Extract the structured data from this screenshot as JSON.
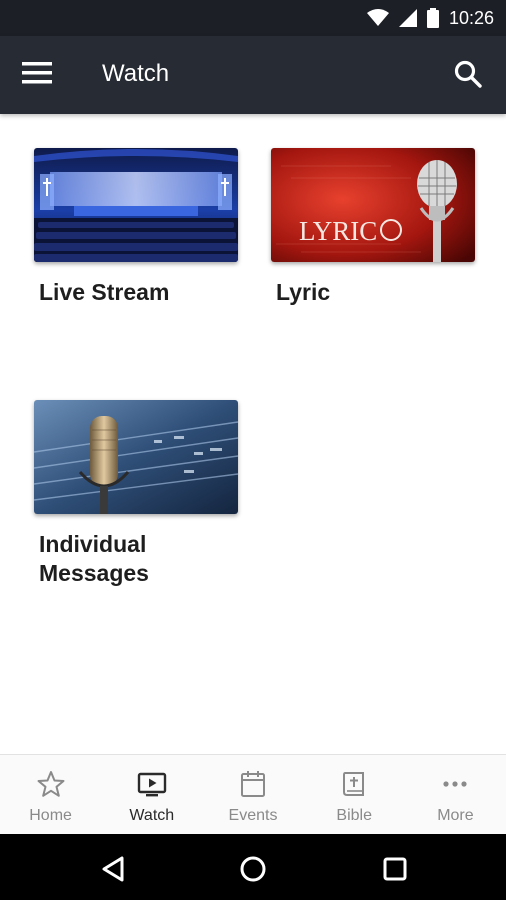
{
  "status_bar": {
    "time": "10:26",
    "icons": [
      "wifi-icon",
      "signal-icon",
      "battery-icon"
    ]
  },
  "app_bar": {
    "title": "Watch",
    "icons": [
      "menu-icon",
      "search-icon"
    ]
  },
  "cards": [
    {
      "title": "Live Stream",
      "thumbnail": "stage-auditorium"
    },
    {
      "title": "Lyric",
      "thumbnail": "lyric-microphone-red",
      "thumbnail_text": "LYRIC"
    },
    {
      "title": "Individual Messages",
      "thumbnail": "studio-microphone-mixer"
    }
  ],
  "bottom_nav": {
    "items": [
      {
        "label": "Home",
        "icon": "star-icon",
        "active": false
      },
      {
        "label": "Watch",
        "icon": "tv-play-icon",
        "active": true
      },
      {
        "label": "Events",
        "icon": "calendar-icon",
        "active": false
      },
      {
        "label": "Bible",
        "icon": "bible-icon",
        "active": false
      },
      {
        "label": "More",
        "icon": "more-dots-icon",
        "active": false
      }
    ]
  },
  "system_nav": {
    "icons": [
      "back-icon",
      "home-circle-icon",
      "recents-icon"
    ]
  },
  "colors": {
    "status_bar": "#1c1f26",
    "app_bar": "#262b34",
    "background": "#ffffff",
    "nav_inactive": "#8a8a8a",
    "nav_active": "#2a2a2a"
  }
}
